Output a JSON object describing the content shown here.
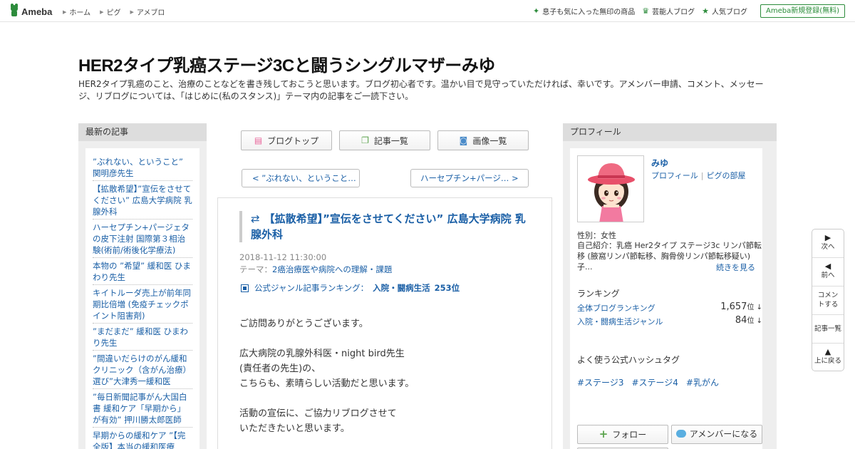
{
  "topbar": {
    "logo": "Ameba",
    "nav": [
      "ホーム",
      "ピグ",
      "アメブロ"
    ],
    "right_links": [
      {
        "icon": "sparkle-icon",
        "label": "息子も気に入った無印の商品"
      },
      {
        "icon": "crown-icon",
        "label": "芸能人ブログ"
      },
      {
        "icon": "star-icon",
        "label": "人気ブログ"
      }
    ],
    "register": "Ameba新規登録(無料)"
  },
  "header": {
    "title": "HER2タイプ乳癌ステージ3Cと闘うシングルマザーみゆ",
    "description": "HER2タイプ乳癌のこと、治療のことなどを書き残しておこうと思います。ブログ初心者です。温かい目で見守っていただければ、幸いです。アメンバー申請、コメント、メッセージ、リブログについては、「はじめに(私のスタンス)」テーマ内の記事をご一読下さい。"
  },
  "left": {
    "heading": "最新の記事",
    "entries": [
      "”ぶれない、ということ” 関明彦先生",
      "【拡散希望】”宣伝をさせてください” 広島大学病院 乳腺外科",
      "ハーセプチン+パージェタの皮下注射 国際第３相治験(術前/術後化学療法)",
      "本物の ”希望” 緩和医 ひまわり先生",
      "キイトルーダ売上が前年同期比倍増 (免疫チェックポイント阻害剤)",
      "”まだまだ” 緩和医 ひまわり先生",
      "”間違いだらけのがん緩和クリニック（含がん治療）選び”大津秀一緩和医",
      "”毎日新聞記事がん大国白書 緩和ケア「早期から」が有効” 押川勝太郎医師",
      "早期からの緩和ケア ”【完全版】本当の緩和医療"
    ]
  },
  "center": {
    "buttons": [
      {
        "icon": "document-icon",
        "label": "ブログトップ"
      },
      {
        "icon": "list-icon",
        "label": "記事一覧"
      },
      {
        "icon": "camera-icon",
        "label": "画像一覧"
      }
    ],
    "prev": "< ”ぶれない、ということ…",
    "next": "ハーセプチン+パージ… >",
    "article": {
      "title": "【拡散希望】”宣伝をさせてください” 広島大学病院 乳腺外科",
      "date": "2018-11-12 11:30:00",
      "theme_label": "テーマ：",
      "theme": "2癌治療医や病院への理解・課題",
      "rank_label": "公式ジャンル記事ランキング：",
      "rank_genre": "入院・闘病生活",
      "rank_value": "253位",
      "body": [
        "ご訪問ありがとうございます。",
        "",
        "広大病院の乳腺外科医・night bird先生",
        "(責任者の先生)の、",
        "こちらも、素晴らしい活動だと思います。",
        "",
        "活動の宣伝に、ご協力リブログさせて",
        "いただきたいと思います。"
      ]
    }
  },
  "right": {
    "heading": "プロフィール",
    "name": "みゆ",
    "profile_link": "プロフィール",
    "pigg_link": "ピグの部屋",
    "gender": "性別：女性",
    "intro": "自己紹介：乳癌 Her2タイプ ステージ3c リンパ節転移 (腋窩リンパ節転移、胸骨傍リンパ節転移疑い) 子...",
    "read_more": "続きを見る",
    "ranking_heading": "ランキング",
    "rankings": [
      {
        "label": "全体ブログランキング",
        "value": "1,657",
        "unit": "位 ↓"
      },
      {
        "label": "入院・闘病生活ジャンル",
        "value": "84",
        "unit": "位 ↓"
      }
    ],
    "hashtag_heading": "よく使う公式ハッシュタグ",
    "hashtags": [
      "#ステージ3",
      "#ステージ4",
      "#乳がん"
    ],
    "follow": "フォロー",
    "amember": "アメンバーになる"
  },
  "floatnav": [
    {
      "icon": "next-icon",
      "glyph": "▶",
      "label": "次へ"
    },
    {
      "icon": "prev-icon",
      "glyph": "◀",
      "label": "前へ"
    },
    {
      "icon": "",
      "glyph": "",
      "label": "コメントする"
    },
    {
      "icon": "",
      "glyph": "",
      "label": "記事一覧"
    },
    {
      "icon": "up-icon",
      "glyph": "▲",
      "label": "上に戻る"
    }
  ]
}
